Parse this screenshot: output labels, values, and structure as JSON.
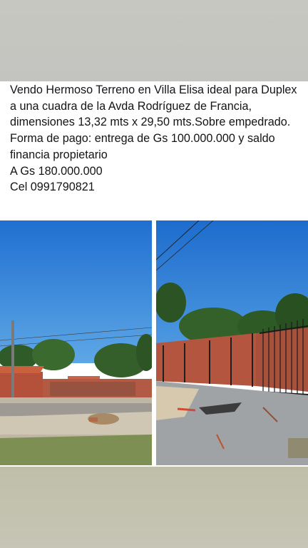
{
  "listing": {
    "description": "Vendo Hermoso Terreno en Villa Elisa ideal para Duplex a una cuadra de la Avda Rodríguez de Francia, dimensiones 13,32 mts  x 29,50 mts.Sobre empedrado.",
    "payment": "Forma de pago: entrega de Gs 100.000.000 y saldo financia propietario",
    "price": "A Gs 180.000.000",
    "phone": "Cel 0991790821"
  },
  "colors": {
    "sky": "#2b83d8",
    "band_top": "#c5c6c1",
    "band_bottom": "#c2c1ad",
    "brick": "#b5513b"
  },
  "photos": [
    {
      "name": "lot-street-view"
    },
    {
      "name": "lot-gate-view"
    }
  ]
}
